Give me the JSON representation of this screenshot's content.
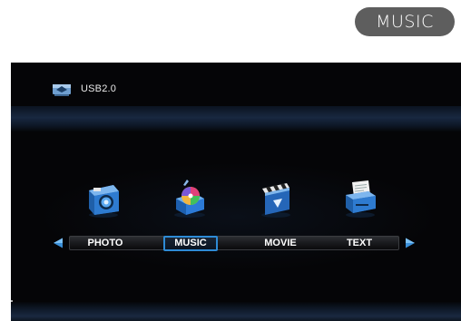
{
  "badge": {
    "label": "MUSIC"
  },
  "source": {
    "label": "USB2.0",
    "icon": "usb-drive-icon"
  },
  "menu": {
    "selected": "MUSIC",
    "items": [
      {
        "label": "PHOTO",
        "icon": "camera-icon"
      },
      {
        "label": "MUSIC",
        "icon": "music-player-icon"
      },
      {
        "label": "MOVIE",
        "icon": "clapperboard-icon"
      },
      {
        "label": "TEXT",
        "icon": "document-printer-icon"
      }
    ],
    "left_arrow": "arrow-left-icon",
    "right_arrow": "arrow-right-icon"
  },
  "colors": {
    "badge_bg": "#5e5e5e",
    "screen_bg": "#050507",
    "selection": "#2e8bd6",
    "arrow": "#3a8fd8"
  }
}
